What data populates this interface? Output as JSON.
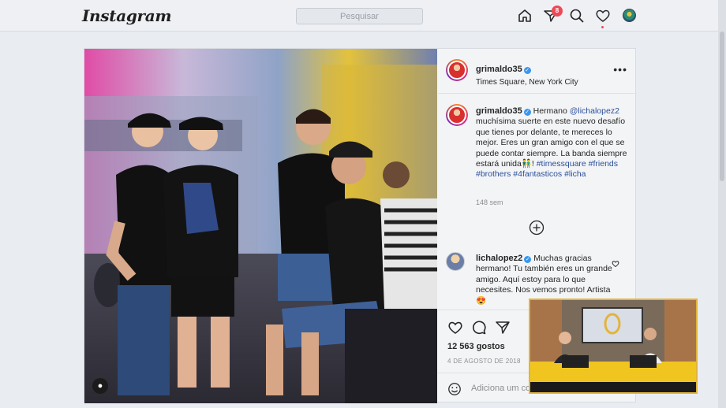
{
  "app": {
    "logo": "Instagram"
  },
  "search": {
    "placeholder": "Pesquisar"
  },
  "nav": {
    "notifications_count": "8",
    "icons": [
      "home-icon",
      "direct-icon",
      "explore-icon",
      "activity-icon",
      "profile-avatar"
    ]
  },
  "post": {
    "username": "grimaldo35",
    "location": "Times Square, New York City",
    "caption": {
      "username": "grimaldo35",
      "mention": "@lichalopez2",
      "text_before": "Hermano",
      "text_after": "muchísima suerte en este nuevo desafío que tienes por delante, te mereces lo mejor. Eres un gran amigo con el que se puede contar siempre. La banda siempre estará unida",
      "emoji": "👬",
      "exclamation": "!",
      "hashtags": [
        "#timessquare",
        "#friends",
        "#brothers",
        "#4fantasticos",
        "#licha"
      ]
    },
    "time_ago": "148 sem",
    "comment": {
      "username": "lichalopez2",
      "text": "Muchas gracias hermano! Tu también eres un grande amigo. Aquí estoy para lo que necesites. Nos vemos pronto! Artista",
      "emoji": "😍"
    },
    "likes": "12 563 gostos",
    "date": "4 DE AGOSTO DE 2018",
    "add_comment_placeholder": "Adiciona um com"
  },
  "colors": {
    "accent": "#3897f0",
    "badge": "#ed4956",
    "overlay_border": "#e2b43b"
  }
}
